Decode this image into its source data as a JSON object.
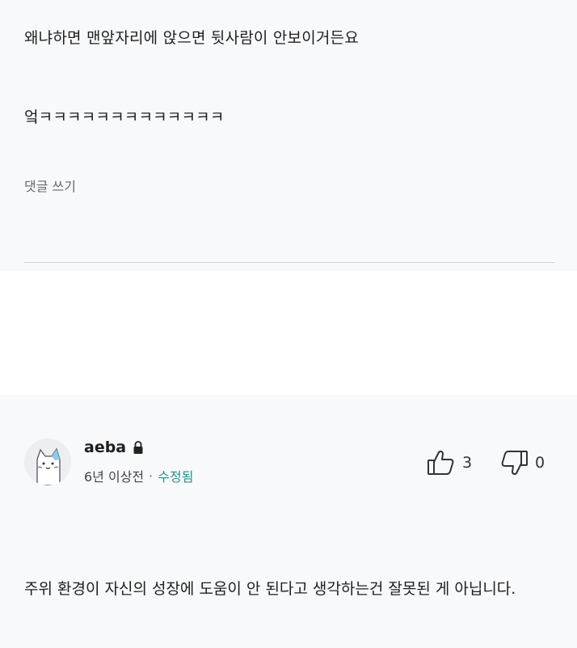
{
  "thread": {
    "replies": [
      "왜냐하면 맨앞자리에 앉으면 뒷사람이 안보이거든요",
      "엌ㅋㅋㅋㅋㅋㅋㅋㅋㅋㅋㅋㅋㅋ"
    ],
    "write_comment_label": "댓글 쓰기"
  },
  "comment": {
    "username": "aeba",
    "lock_icon": "lock-icon",
    "time": "6년 이상전",
    "separator": "·",
    "edited": "수정됨",
    "likes": "3",
    "dislikes": "0",
    "body": "주위 환경이 자신의 성장에 도움이 안 된다고 생각하는건 잘못된 게 아닙니다.",
    "colors": {
      "edited": "#2a8f8a",
      "background": "#f8f9fb"
    }
  }
}
